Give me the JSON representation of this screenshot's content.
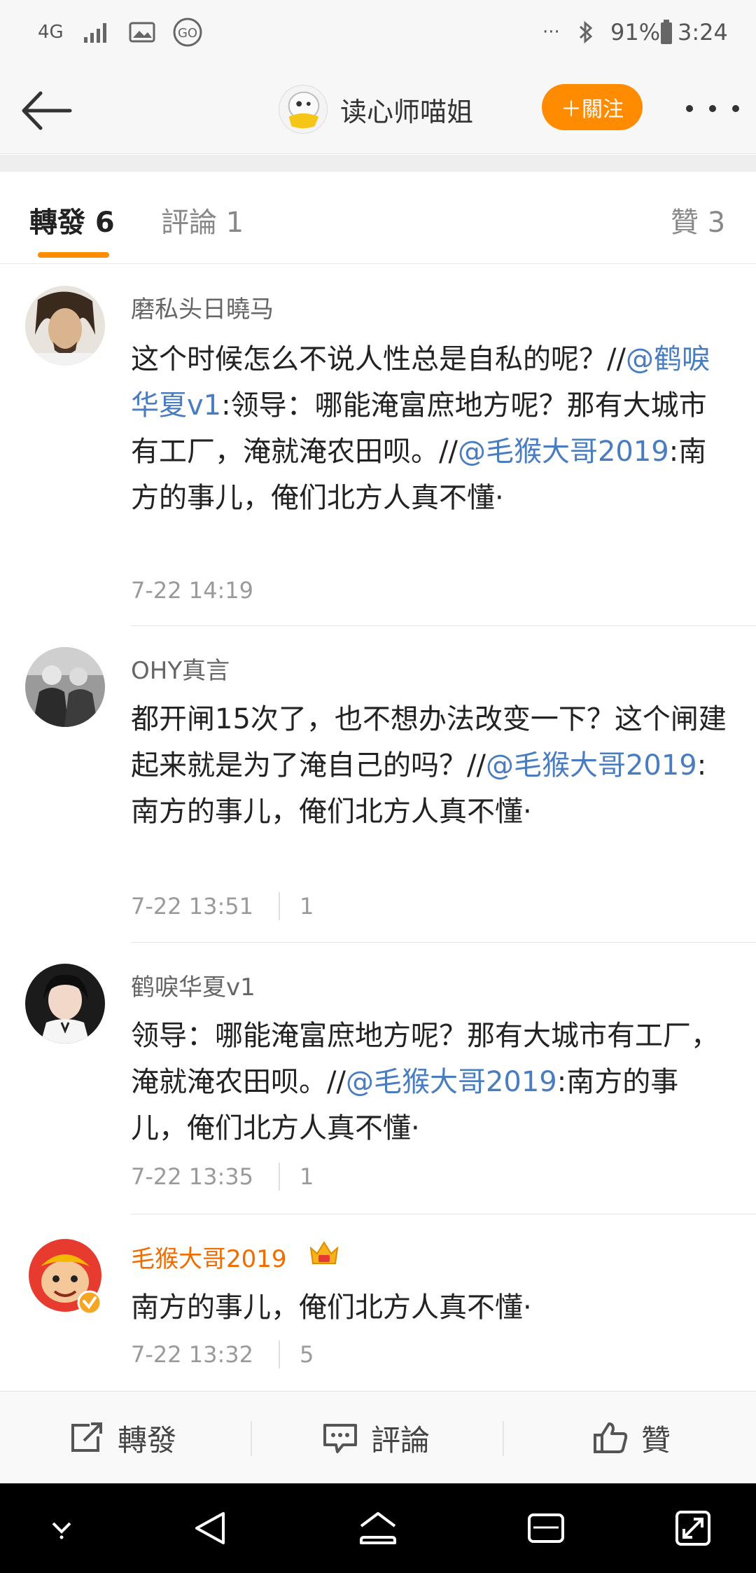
{
  "status_bar": {
    "network": "4G",
    "more": "···",
    "battery": "91%",
    "time": "3:24"
  },
  "header": {
    "name": "读心师喵姐",
    "follow_label": "＋關注"
  },
  "tabs": [
    {
      "label": "轉發 6"
    },
    {
      "label": "評論 1"
    },
    {
      "label": "贊 3"
    }
  ],
  "feed": [
    {
      "user": "磨私头日曉马",
      "segments": [
        {
          "text": "这个时候怎么不说人性总是自私的呢？//",
          "mention": false
        },
        {
          "text": "@鹤唳华夏v1",
          "mention": true
        },
        {
          "text": ":领导：哪能淹富庶地方呢？那有大城市有工厂，淹就淹农田呗。//",
          "mention": false
        },
        {
          "text": "@毛猴大哥2019",
          "mention": true
        },
        {
          "text": ":南方的事儿，俺们北方人真不懂·",
          "mention": false
        }
      ],
      "time": "7-22 14:19",
      "count": ""
    },
    {
      "user": "OHY真言",
      "segments": [
        {
          "text": "都开闸15次了，也不想办法改变一下？这个闸建起来就是为了淹自己的吗？//",
          "mention": false
        },
        {
          "text": "@毛猴大哥2019",
          "mention": true
        },
        {
          "text": ":南方的事儿，俺们北方人真不懂·",
          "mention": false
        }
      ],
      "time": "7-22 13:51",
      "count": "1"
    },
    {
      "user": "鹤唳华夏v1",
      "segments": [
        {
          "text": "领导：哪能淹富庶地方呢？那有大城市有工厂，淹就淹农田呗。//",
          "mention": false
        },
        {
          "text": "@毛猴大哥2019",
          "mention": true
        },
        {
          "text": ":南方的事儿，俺们北方人真不懂·",
          "mention": false
        }
      ],
      "time": "7-22 13:35",
      "count": "1"
    },
    {
      "user": "毛猴大哥2019",
      "segments": [
        {
          "text": "南方的事儿，俺们北方人真不懂·",
          "mention": false
        }
      ],
      "time": "7-22 13:32",
      "count": "5"
    }
  ],
  "actions": {
    "repost": "轉發",
    "comment": "評論",
    "like": "贊"
  },
  "colors": {
    "accent": "#ff8c00",
    "mention": "#4a7cc0",
    "vip_name": "#f06c00"
  }
}
